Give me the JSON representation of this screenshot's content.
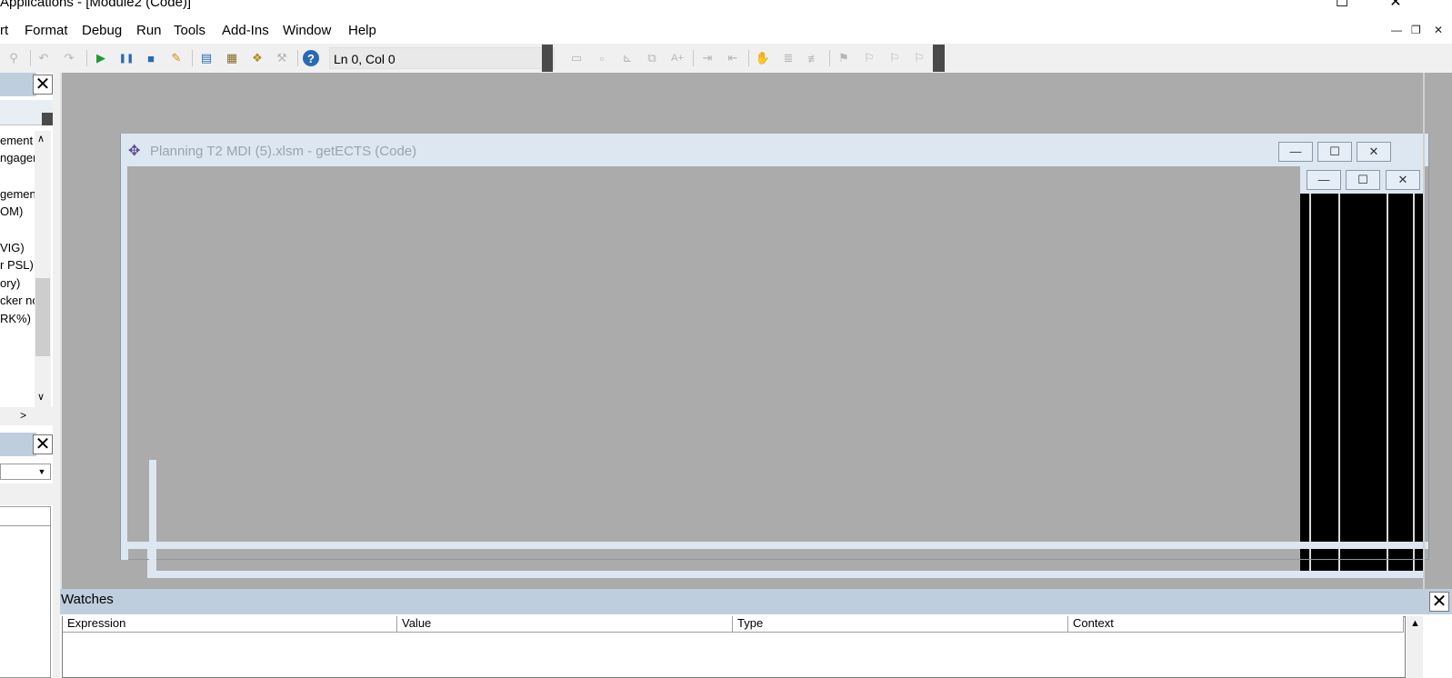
{
  "window": {
    "title": "Applications - [Module2 (Code)]",
    "min_glyph": "—",
    "max_glyph": "☐",
    "close_glyph": "✕"
  },
  "menu": {
    "items": [
      "rt",
      "Format",
      "Debug",
      "Run",
      "Tools",
      "Add-Ins",
      "Window",
      "Help"
    ],
    "mdi_min": "—",
    "mdi_restore": "❐",
    "mdi_close": "✕"
  },
  "toolbar": {
    "position": "Ln 0, Col 0",
    "icons": [
      "find-icon",
      "undo-icon",
      "redo-icon",
      "run-icon",
      "break-icon",
      "reset-icon",
      "design-mode-icon",
      "project-explorer-icon",
      "properties-icon",
      "object-browser-icon",
      "toolbox-icon",
      "help-icon",
      "list-properties-icon",
      "list-constants-icon",
      "quick-info-icon",
      "parameter-info-icon",
      "complete-word-icon",
      "indent-icon",
      "outdent-icon",
      "toggle-breakpoint-icon",
      "comment-block-icon",
      "uncomment-block-icon",
      "toggle-bookmark-icon",
      "next-bookmark-icon",
      "previous-bookmark-icon",
      "clear-bookmarks-icon"
    ]
  },
  "project_panel": {
    "close_glyph": "✕",
    "items": [
      "ement",
      "ngager",
      "",
      "gemen",
      "OM)",
      "",
      "VIG)",
      "r PSL)",
      "ory)",
      "cker nc",
      "RK%)"
    ]
  },
  "child_window": {
    "title": "Planning T2 MDI (5).xlsm - getECTS (Code)",
    "min_glyph": "—",
    "max_glyph": "☐",
    "close_glyph": "✕"
  },
  "watches": {
    "title": "Watches",
    "close_glyph": "✕",
    "columns": [
      "Expression",
      "Value",
      "Type",
      "Context"
    ]
  },
  "colors": {
    "panel_title": "#bfcedd",
    "mdi_background": "#ababab",
    "child_title": "#dde7f2"
  }
}
